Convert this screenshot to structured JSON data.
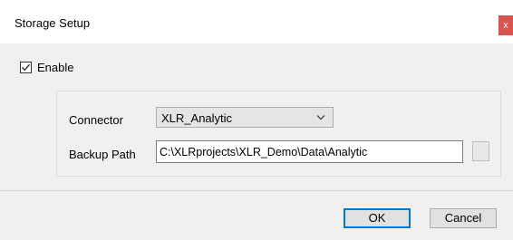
{
  "window": {
    "title": "Storage Setup",
    "close_glyph": "x"
  },
  "enable": {
    "label": "Enable",
    "checked": true
  },
  "form": {
    "connector_label": "Connector",
    "connector_value": "XLR_Analytic",
    "backup_label": "Backup Path",
    "backup_value": "C:\\XLRprojects\\XLR_Demo\\Data\\Analytic"
  },
  "buttons": {
    "ok_label": "OK",
    "cancel_label": "Cancel"
  },
  "icons": {
    "checkbox": "check-icon",
    "dropdown": "chevron-down-icon",
    "close": "close-icon"
  },
  "colors": {
    "accent": "#0078d7",
    "close_button": "#d9534f",
    "panel_background": "#f0f0f0"
  }
}
